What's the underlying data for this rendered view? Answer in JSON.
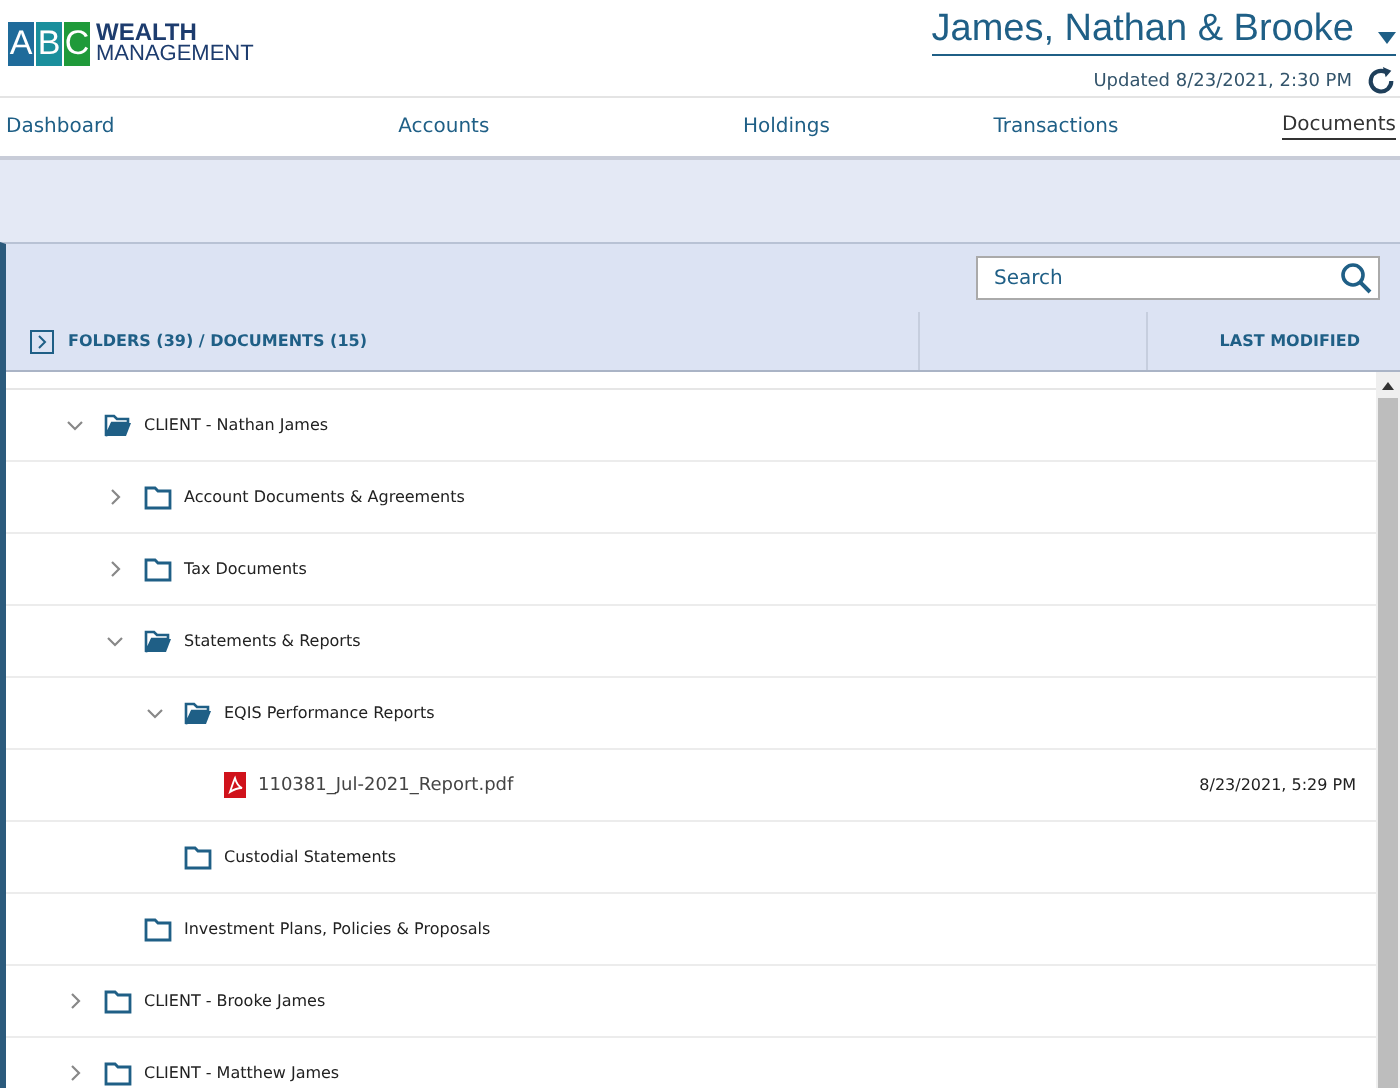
{
  "logo": {
    "letters": [
      "A",
      "B",
      "C"
    ],
    "line_1": "WEALTH",
    "line_2": "MANAGEMENT"
  },
  "household": {
    "name": "James, Nathan & Brooke",
    "updated": "Updated 8/23/2021, 2:30 PM"
  },
  "tabs": [
    {
      "label": "Dashboard",
      "selected": false
    },
    {
      "label": "Accounts",
      "selected": false
    },
    {
      "label": "Holdings",
      "selected": false
    },
    {
      "label": "Transactions",
      "selected": false
    },
    {
      "label": "Documents",
      "selected": true
    }
  ],
  "search": {
    "placeholder": "Search"
  },
  "columns": [
    "FOLDERS (39) / DOCUMENTS (15)",
    "LAST MODIFIED"
  ],
  "tree": [
    {
      "kind": "folder",
      "name": "CLIENT - Nathan James",
      "expanded": true,
      "children": [
        {
          "kind": "folder",
          "name": "Account Documents & Agreements",
          "expanded": false
        },
        {
          "kind": "folder",
          "name": "Tax Documents",
          "expanded": false
        },
        {
          "kind": "folder",
          "name": "Statements & Reports",
          "expanded": true,
          "children": [
            {
              "kind": "folder",
              "name": "EQIS Performance Reports",
              "expanded": true,
              "children": [
                {
                  "kind": "file",
                  "name": "110381_Jul-2021_Report.pdf",
                  "modified": "8/23/2021, 5:29 PM"
                }
              ]
            },
            {
              "kind": "folder",
              "name": "Custodial Statements"
            }
          ]
        },
        {
          "kind": "folder",
          "name": "Investment Plans, Policies & Proposals"
        }
      ]
    },
    {
      "kind": "folder",
      "name": "CLIENT - Brooke James",
      "expanded": false
    },
    {
      "kind": "folder",
      "name": "CLIENT - Matthew James",
      "expanded": false
    }
  ]
}
